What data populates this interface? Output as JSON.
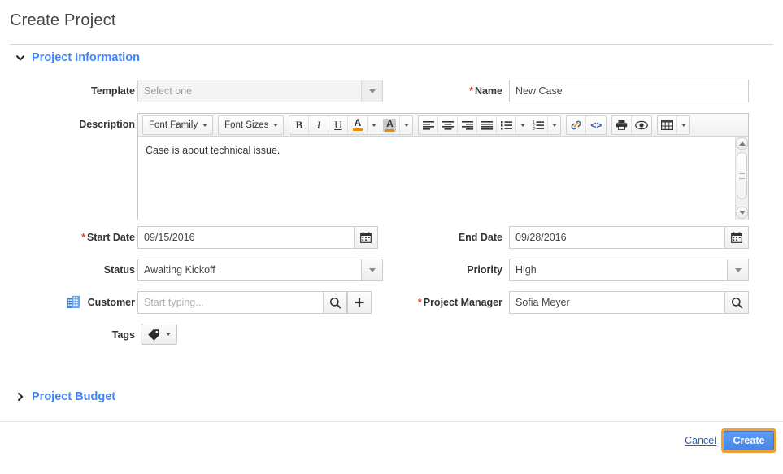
{
  "header": {
    "title": "Create Project"
  },
  "sections": {
    "project_information": {
      "label": "Project Information",
      "expanded": true,
      "caret_icon": "chevron-down-icon"
    },
    "project_budget": {
      "label": "Project Budget",
      "expanded": false,
      "caret_icon": "chevron-right-icon"
    }
  },
  "fields": {
    "template": {
      "label": "Template",
      "required": false,
      "value": "",
      "placeholder": "Select one",
      "disabled": true
    },
    "name": {
      "label": "Name",
      "required": true,
      "required_marker": "*",
      "value": "New Case",
      "placeholder": ""
    },
    "description": {
      "label": "Description",
      "required": false,
      "value": "Case is about technical issue."
    },
    "start_date": {
      "label": "Start Date",
      "required": true,
      "required_marker": "*",
      "value": "09/15/2016",
      "button_icon": "calendar-icon"
    },
    "end_date": {
      "label": "End Date",
      "required": false,
      "value": "09/28/2016",
      "button_icon": "calendar-icon"
    },
    "status": {
      "label": "Status",
      "required": false,
      "value": "Awaiting Kickoff"
    },
    "priority": {
      "label": "Priority",
      "required": false,
      "value": "High"
    },
    "customer": {
      "label": "Customer",
      "required": false,
      "label_icon": "building-icon",
      "value": "",
      "placeholder": "Start typing...",
      "search_icon": "search-icon",
      "add_icon": "plus-icon"
    },
    "project_manager": {
      "label": "Project Manager",
      "required": true,
      "required_marker": "*",
      "value": "Sofia Meyer",
      "search_icon": "search-icon"
    },
    "tags": {
      "label": "Tags",
      "required": false,
      "button_icon": "tag-icon",
      "caret_icon": "chevron-down-icon"
    }
  },
  "editor_toolbar": {
    "font_family": {
      "label": "Font Family",
      "icon": "chevron-down-icon"
    },
    "font_sizes": {
      "label": "Font Sizes",
      "icon": "chevron-down-icon"
    },
    "bold": {
      "label": "B",
      "icon": "bold-icon"
    },
    "italic": {
      "label": "I",
      "icon": "italic-icon"
    },
    "underline": {
      "label": "U",
      "icon": "underline-icon"
    },
    "text_color": {
      "label": "A",
      "icon": "text-color-icon",
      "accent": "#e8890c"
    },
    "background_color": {
      "label": "A",
      "icon": "background-color-icon",
      "accent": "#e8890c"
    },
    "align_left": {
      "icon": "align-left-icon"
    },
    "align_center": {
      "icon": "align-center-icon"
    },
    "align_right": {
      "icon": "align-right-icon"
    },
    "align_justify": {
      "icon": "align-justify-icon"
    },
    "bullet_list": {
      "icon": "bullet-list-icon"
    },
    "numbered_list": {
      "icon": "numbered-list-icon"
    },
    "insert_link": {
      "icon": "link-icon"
    },
    "source_code": {
      "icon": "code-icon",
      "label": "<>"
    },
    "print": {
      "icon": "print-icon"
    },
    "preview": {
      "icon": "eye-icon"
    },
    "table": {
      "icon": "table-icon"
    }
  },
  "footer": {
    "cancel_label": "Cancel",
    "create_label": "Create",
    "create_focused": true
  },
  "colors": {
    "link_blue": "#4285f4",
    "required_red": "#d9443f",
    "primary_button": "#4a86e8",
    "focus_ring": "#f0a030",
    "cancel_link": "#2a5db0"
  }
}
